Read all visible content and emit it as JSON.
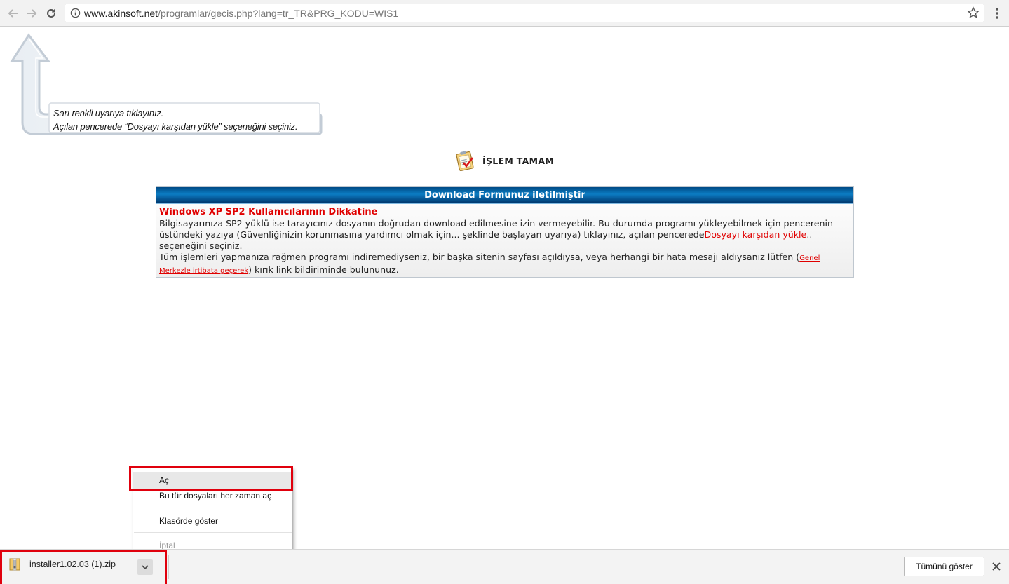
{
  "browser": {
    "url_host": "www.akinsoft.net",
    "url_path": "/programlar/gecis.php?lang=tr_TR&PRG_KODU=WIS1"
  },
  "callout": {
    "line1": "Sarı renkli uyarıya tıklayınız.",
    "line2": "Açılan pencerede “Dosyayı karşıdan yükle” seçeneğini seçiniz."
  },
  "status": {
    "text": "İŞLEM TAMAM"
  },
  "infobox": {
    "header": "Download Formunuz iletilmiştir",
    "warning_title": "Windows XP SP2 Kullanıcılarının Dikkatine",
    "p1_a": "Bilgisayarınıza SP2 yüklü ise tarayıcınız dosyanın doğrudan download edilmesine izin vermeyebilir. Bu durumda programı yükleyebilmek için pencerenin üstündeki yazıya (Güvenliğinizin korunmasına yardımcı olmak için... şeklinde başlayan uyarıya) tıklayınız, açılan pencerede",
    "p1_red": "Dosyayı karşıdan yükle",
    "p1_b": ".. seçeneğini seçiniz.",
    "p2_a": "Tüm işlemleri yapmanıza rağmen programı indiremediyseniz, bir başka sitenin sayfası açıldıysa, veya herhangi bir hata mesajı aldıysanız lütfen (",
    "p2_link": "Genel Merkezle irtibata geçerek",
    "p2_b": ") kırık link bildiriminde bulununuz."
  },
  "context_menu": {
    "open": "Aç",
    "always_open": "Bu tür dosyaları her zaman aç",
    "show_in_folder": "Klasörde göster",
    "cancel": "İptal"
  },
  "download_shelf": {
    "file_name": "installer1.02.03 (1).zip",
    "show_all": "Tümünü göster"
  },
  "colors": {
    "accent_red": "#e0000d",
    "header_blue": "#0b7cc2"
  }
}
